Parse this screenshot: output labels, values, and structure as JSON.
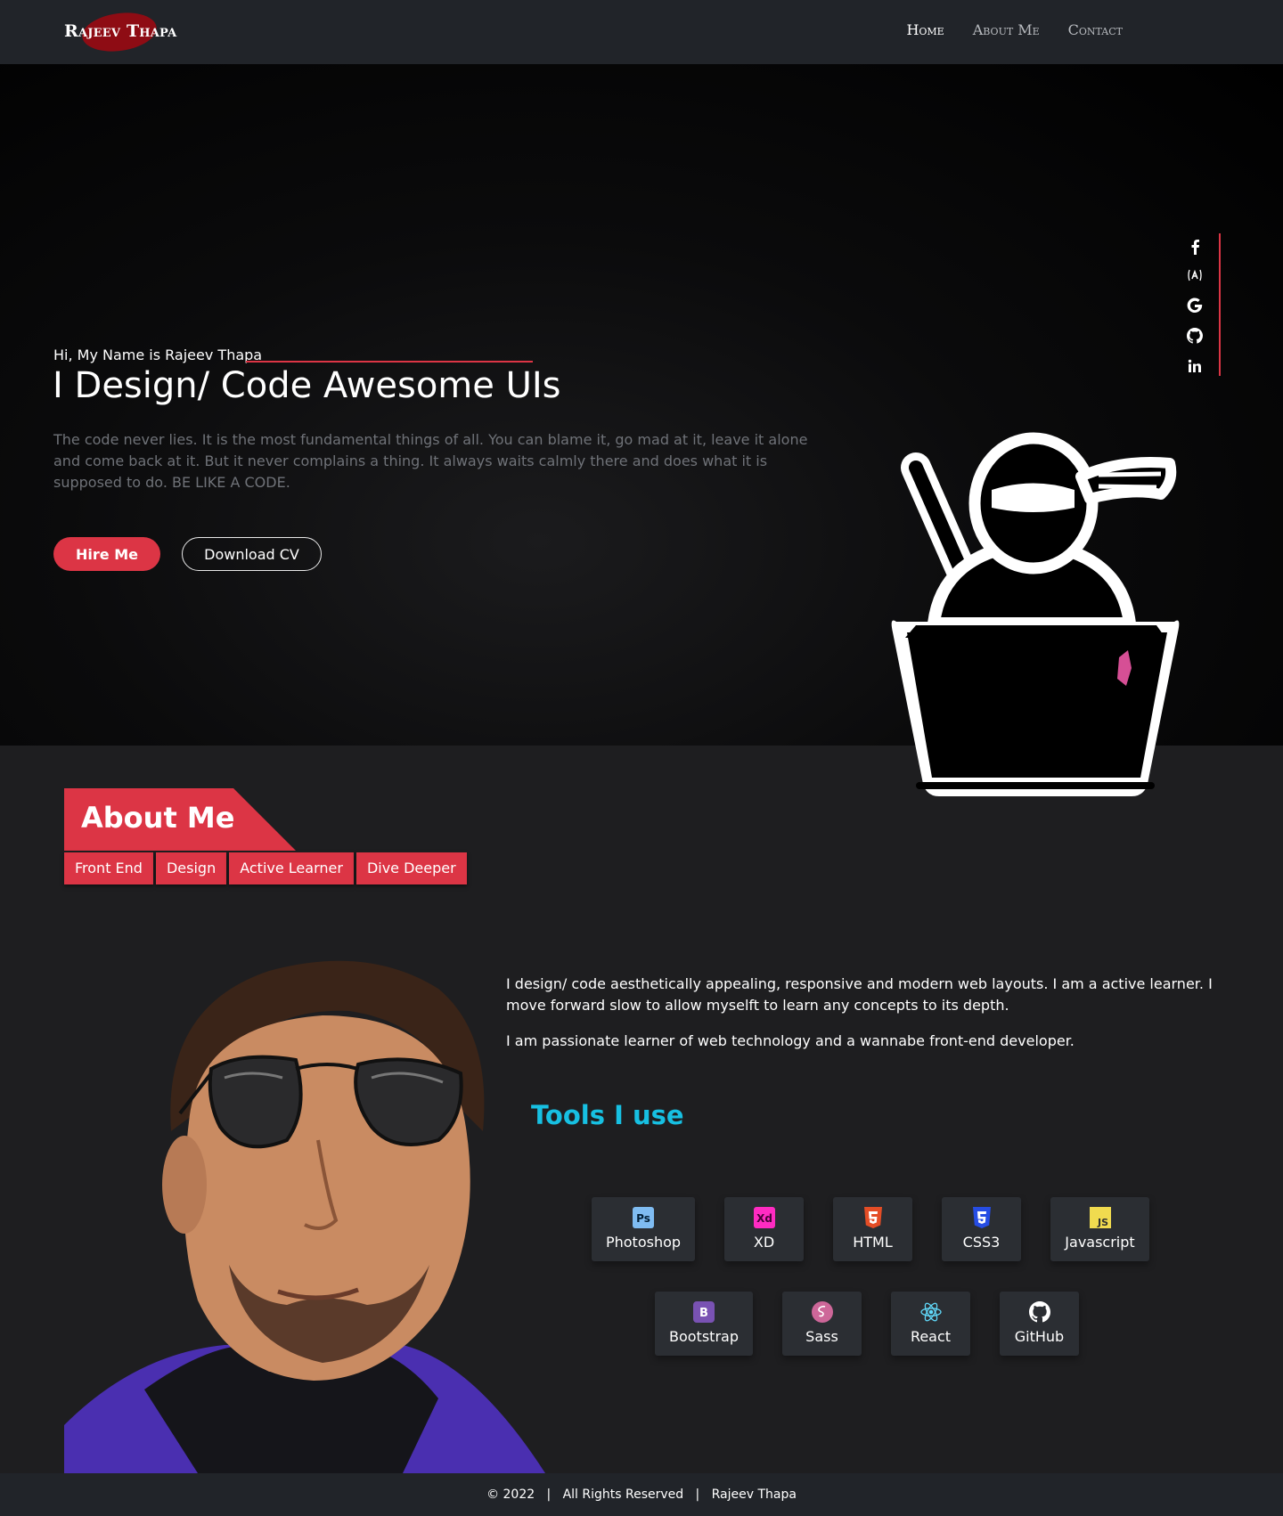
{
  "nav": {
    "brand": "Rajeev Thapa",
    "links": [
      "Home",
      "About Me",
      "Contact"
    ]
  },
  "hero": {
    "greeting": "Hi, My Name is Rajeev Thapa",
    "title": "I Design/ Code Awesome UIs",
    "text": "The code never lies. It is the most fundamental things of all. You can blame it, go mad at it, leave it alone and come back at it. But it never complains a thing. It always waits calmly there and does what it is supposed to do. BE LIKE A CODE.",
    "hire_label": "Hire Me",
    "cv_label": "Download CV"
  },
  "social": [
    "facebook-icon",
    "angular-icon",
    "google-icon",
    "github-icon",
    "linkedin-icon"
  ],
  "about": {
    "title": "About Me",
    "tags": [
      "Front End",
      "Design",
      "Active Learner",
      "Dive Deeper"
    ],
    "p1": "I design/ code aesthetically appealing, responsive and modern web layouts. I am a active learner. I move forward slow to allow myselft to learn any concepts to its depth.",
    "p2": "I am passionate learner of web technology and a wannabe front-end developer.",
    "tools_title": "Tools I use",
    "tools": [
      {
        "label": "Photoshop",
        "icon": "photoshop-icon",
        "color": "#31a8ff"
      },
      {
        "label": "XD",
        "icon": "xd-icon",
        "color": "#ff2bc2"
      },
      {
        "label": "HTML",
        "icon": "html5-icon",
        "color": "#e44d26"
      },
      {
        "label": "CSS3",
        "icon": "css3-icon",
        "color": "#264de4"
      },
      {
        "label": "Javascript",
        "icon": "javascript-icon",
        "color": "#f0db4f"
      },
      {
        "label": "Bootstrap",
        "icon": "bootstrap-icon",
        "color": "#7952b3"
      },
      {
        "label": "Sass",
        "icon": "sass-icon",
        "color": "#cd6799"
      },
      {
        "label": "React",
        "icon": "react-icon",
        "color": "#61dafb"
      },
      {
        "label": "GitHub",
        "icon": "github-icon",
        "color": "#ffffff"
      }
    ]
  },
  "footer": {
    "copyright": "© 2022",
    "rights": "All Rights Reserved",
    "name": "Rajeev Thapa",
    "sep": "|"
  },
  "colors": {
    "accent": "#dc3545",
    "tools_title": "#17c0e2",
    "nav_bg": "#212429"
  }
}
